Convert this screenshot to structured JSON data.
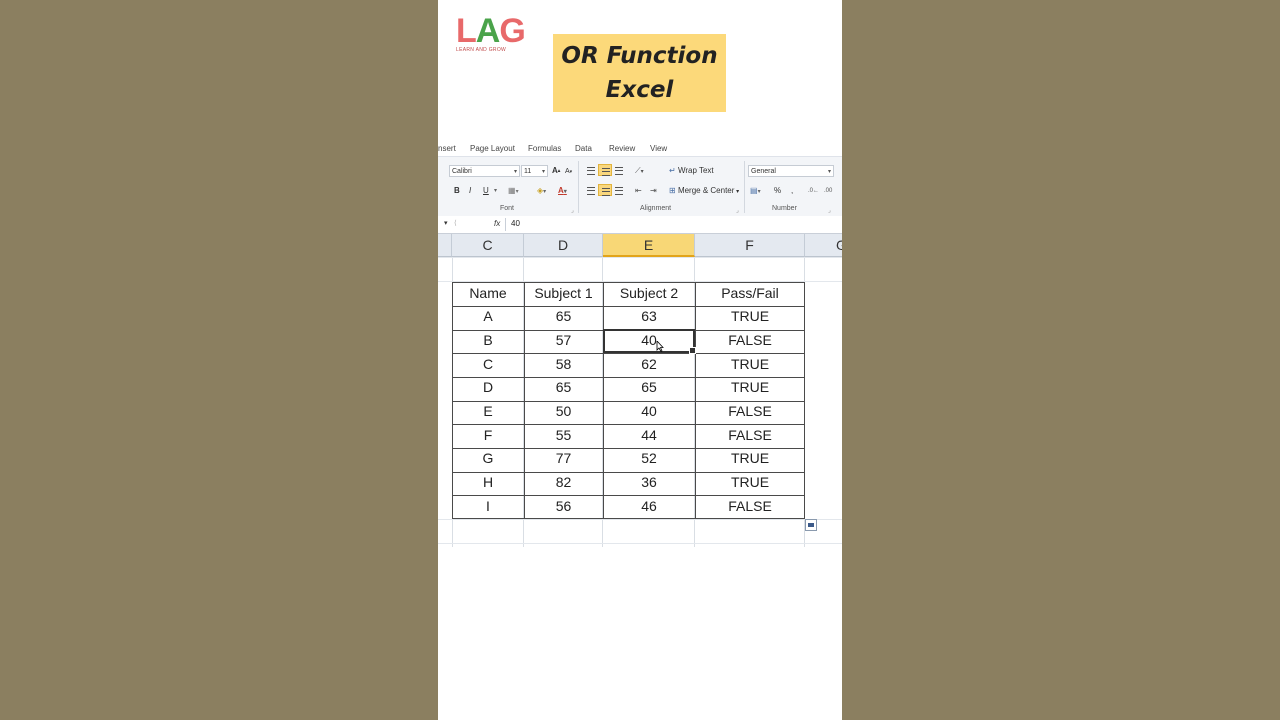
{
  "brand": {
    "logo_letters_l": "L",
    "logo_letters_a": "A",
    "logo_letters_g": "G",
    "tagline": "LEARN AND GROW"
  },
  "title": {
    "line1": "OR Function",
    "line2": "Excel"
  },
  "ribbon_tabs": [
    "nsert",
    "Page Layout",
    "Formulas",
    "Data",
    "Review",
    "View"
  ],
  "ribbon": {
    "font_name": "Calibri",
    "font_size": "11",
    "bold": "B",
    "italic": "I",
    "underline": "U",
    "wrap_text": "Wrap Text",
    "merge_center": "Merge & Center",
    "number_format": "General",
    "percent": "%",
    "comma": ",",
    "group_font": "Font",
    "group_alignment": "Alignment",
    "group_number": "Number"
  },
  "formula_bar": {
    "fx": "fx",
    "value": "40"
  },
  "columns": [
    "C",
    "D",
    "E",
    "F",
    "G"
  ],
  "selected_column": "E",
  "table": {
    "headers": [
      "Name",
      "Subject 1",
      "Subject 2",
      "Pass/Fail"
    ],
    "rows": [
      [
        "A",
        "65",
        "63",
        "TRUE"
      ],
      [
        "B",
        "57",
        "40",
        "FALSE"
      ],
      [
        "C",
        "58",
        "62",
        "TRUE"
      ],
      [
        "D",
        "65",
        "65",
        "TRUE"
      ],
      [
        "E",
        "50",
        "40",
        "FALSE"
      ],
      [
        "F",
        "55",
        "44",
        "FALSE"
      ],
      [
        "G",
        "77",
        "52",
        "TRUE"
      ],
      [
        "H",
        "82",
        "36",
        "TRUE"
      ],
      [
        "I",
        "56",
        "46",
        "FALSE"
      ]
    ]
  },
  "colors": {
    "title_bg": "#fcd97a",
    "selected_col": "#f8d776",
    "page_bg": "#8b7f60"
  }
}
